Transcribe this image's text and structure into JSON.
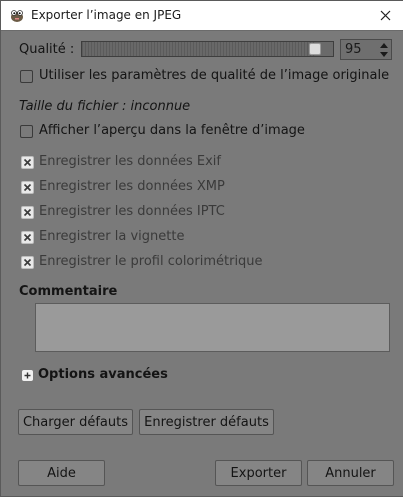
{
  "window": {
    "title": "Exporter l’image en JPEG"
  },
  "quality": {
    "label": "Qualité :",
    "value": "95",
    "level": 0.95
  },
  "checkboxes": {
    "use_original_quality": {
      "label": "Utiliser les paramètres de qualité de l’image originale",
      "checked": false
    },
    "show_preview": {
      "label": "Afficher l’aperçu dans la fenêtre d’image",
      "checked": false
    },
    "save_exif": {
      "label": "Enregistrer les données Exif",
      "checked": true
    },
    "save_xmp": {
      "label": "Enregistrer les données XMP",
      "checked": true
    },
    "save_iptc": {
      "label": "Enregistrer les données IPTC",
      "checked": true
    },
    "save_thumbnail": {
      "label": "Enregistrer la vignette",
      "checked": true
    },
    "save_color_profile": {
      "label": "Enregistrer le profil colorimétrique",
      "checked": true
    }
  },
  "file_size": "Taille du fichier : inconnue",
  "comment": {
    "heading": "Commentaire",
    "value": ""
  },
  "advanced": {
    "label": "Options avancées"
  },
  "buttons": {
    "load_defaults": "Charger défauts",
    "save_defaults": "Enregistrer défauts",
    "help": "Aide",
    "export": "Exporter",
    "cancel": "Annuler"
  }
}
